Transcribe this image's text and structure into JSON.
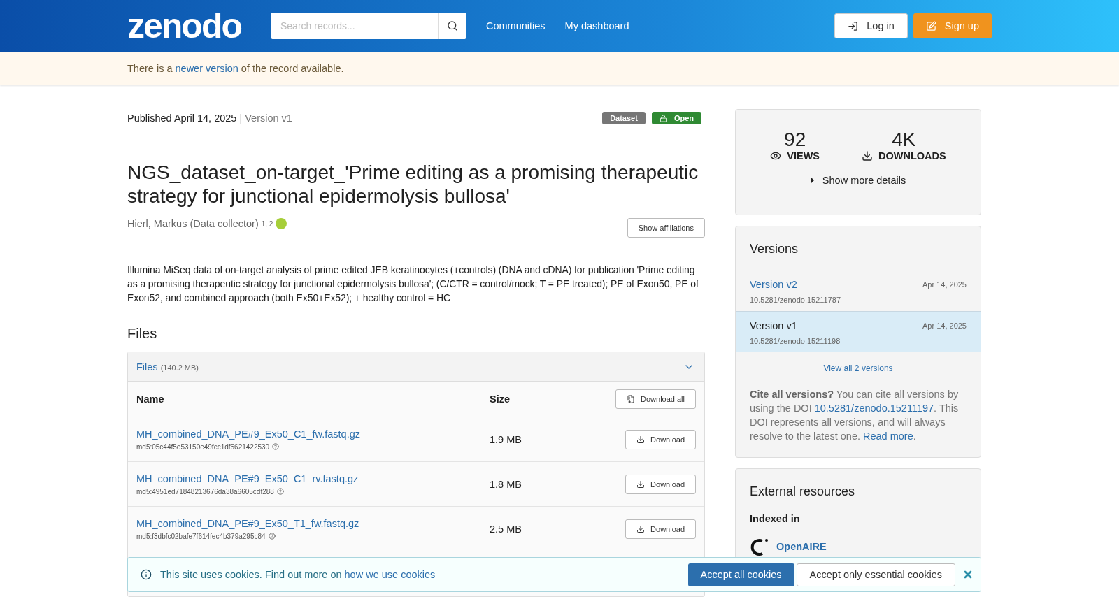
{
  "header": {
    "logo": "zenodo",
    "search": {
      "placeholder": "Search records..."
    },
    "nav": [
      "Communities",
      "My dashboard"
    ],
    "login": "Log in",
    "signup": "Sign up"
  },
  "notice": {
    "before": "There is a ",
    "link": "newer version",
    "after": " of the record available."
  },
  "record": {
    "published": "Published April 14, 2025",
    "version": "| Version v1",
    "badges": [
      {
        "label": "Dataset",
        "kind": "type"
      },
      {
        "label": "Open",
        "kind": "access"
      }
    ],
    "title": "NGS_dataset_on-target_'Prime editing as a promising therapeutic strategy for junctional epidermolysis bullosa'",
    "creator": {
      "name": "Hierl, Markus (Data collector)",
      "affiliations": "1, 2"
    },
    "show_affiliations": "Show affiliations",
    "description": "Illumina MiSeq data of on-target analysis of prime edited JEB keratinocytes (+controls) (DNA and cDNA) for publication 'Prime editing as a promising therapeutic strategy for junctional epidermolysis bullosa'; (C/CTR = control/mock; T = PE treated); PE of Exon50, PE of Exon52, and combined approach (both Ex50+Ex52); + healthy control = HC"
  },
  "files": {
    "heading": "Files",
    "panel": {
      "title": "Files",
      "size": "(140.2 MB)",
      "expanded": true
    },
    "columns": [
      "Name",
      "Size"
    ],
    "download_all": "Download all",
    "rows": [
      {
        "name": "MH_combined_DNA_PE#9_Ex50_C1_fw.fastq.gz",
        "md5": "md5:05c44f5e53150e49fcc1df5621422530",
        "size": "1.9 MB",
        "button": "Download"
      },
      {
        "name": "MH_combined_DNA_PE#9_Ex50_C1_rv.fastq.gz",
        "md5": "md5:4951ed71848213676da38a6605cdf288",
        "size": "1.8 MB",
        "button": "Download"
      },
      {
        "name": "MH_combined_DNA_PE#9_Ex50_T1_fw.fastq.gz",
        "md5": "md5:f3dbfc02bafe7f614fec4b379a295c84",
        "size": "2.5 MB",
        "button": "Download"
      }
    ]
  },
  "sidebar": {
    "stats": [
      {
        "value": "92",
        "label": "VIEWS",
        "kind": "views"
      },
      {
        "value": "4K",
        "label": "DOWNLOADS",
        "kind": "downloads"
      }
    ],
    "more_details": "Show more details",
    "versions": {
      "title": "Versions",
      "items": [
        {
          "label": "Version v2",
          "date": "Apr 14, 2025",
          "doi": "10.5281/zenodo.15211787",
          "selected": false
        },
        {
          "label": "Version v1",
          "date": "Apr 14, 2025",
          "doi": "10.5281/zenodo.15211198",
          "selected": true
        }
      ],
      "view_all": "View all 2 versions",
      "cite": {
        "bold": "Cite all versions?",
        "text1": " You can cite all versions by using the DOI ",
        "doi": "10.5281/zenodo.15211197",
        "text2": ". This DOI represents all versions, and will always resolve to the latest one. ",
        "read_more": "Read more",
        "end": "."
      }
    },
    "external": {
      "title": "External resources",
      "indexed_in": "Indexed in",
      "link": "OpenAIRE"
    }
  },
  "cookie": {
    "text": "This site uses cookies. Find out more on ",
    "link": "how we use cookies",
    "accept_all": "Accept all cookies",
    "accept_essential": "Accept only essential cookies"
  }
}
